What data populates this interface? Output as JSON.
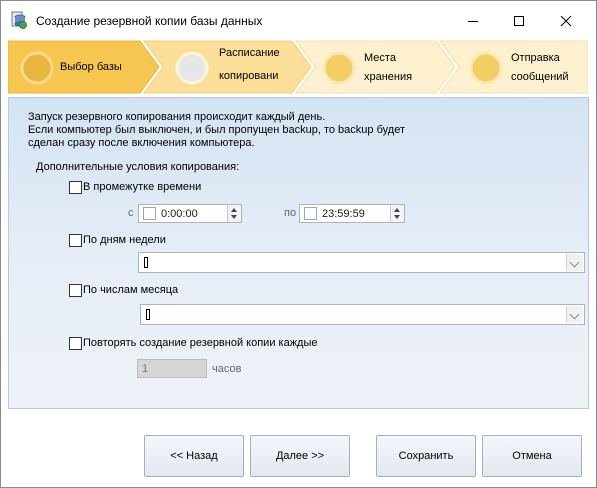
{
  "window": {
    "title": "Создание резервной копии базы данных"
  },
  "steps": [
    {
      "label_line1": "Выбор базы",
      "label_line2": "",
      "state": "completed"
    },
    {
      "label_line1": "Расписание",
      "label_line2": "копировани",
      "state": "current"
    },
    {
      "label_line1": "Места",
      "label_line2": "хранения",
      "state": "pending"
    },
    {
      "label_line1": "Отправка",
      "label_line2": "сообщений",
      "state": "pending"
    }
  ],
  "info_lines": [
    "Запуск резервного копирования происходит каждый день.",
    "Если компьютер был выключен, и был пропущен backup, то backup будет",
    "сделан сразу после включения компьютера."
  ],
  "extra_conditions_label": "Дополнительные условия копирования:",
  "time_range": {
    "checkbox_label": "В промежутке времени",
    "checked": false,
    "from_label": "с",
    "from_value": "0:00:00",
    "to_label": "по",
    "to_value": "23:59:59"
  },
  "weekdays": {
    "checkbox_label": "По дням недели",
    "checked": false,
    "value": ""
  },
  "month_days": {
    "checkbox_label": "По числам месяца",
    "checked": false,
    "value": ""
  },
  "repeat": {
    "checkbox_label": "Повторять создание резервной копии каждые",
    "checked": false,
    "value": "1",
    "unit": "часов"
  },
  "buttons": {
    "back": "<< Назад",
    "next": "Далее >>",
    "save": "Сохранить",
    "cancel": "Отмена"
  },
  "colors": {
    "step_done": "#f6c64a",
    "step_current": "#fbe0a0",
    "step_pending": "#fce9b8",
    "panel": "#dce7f4"
  }
}
